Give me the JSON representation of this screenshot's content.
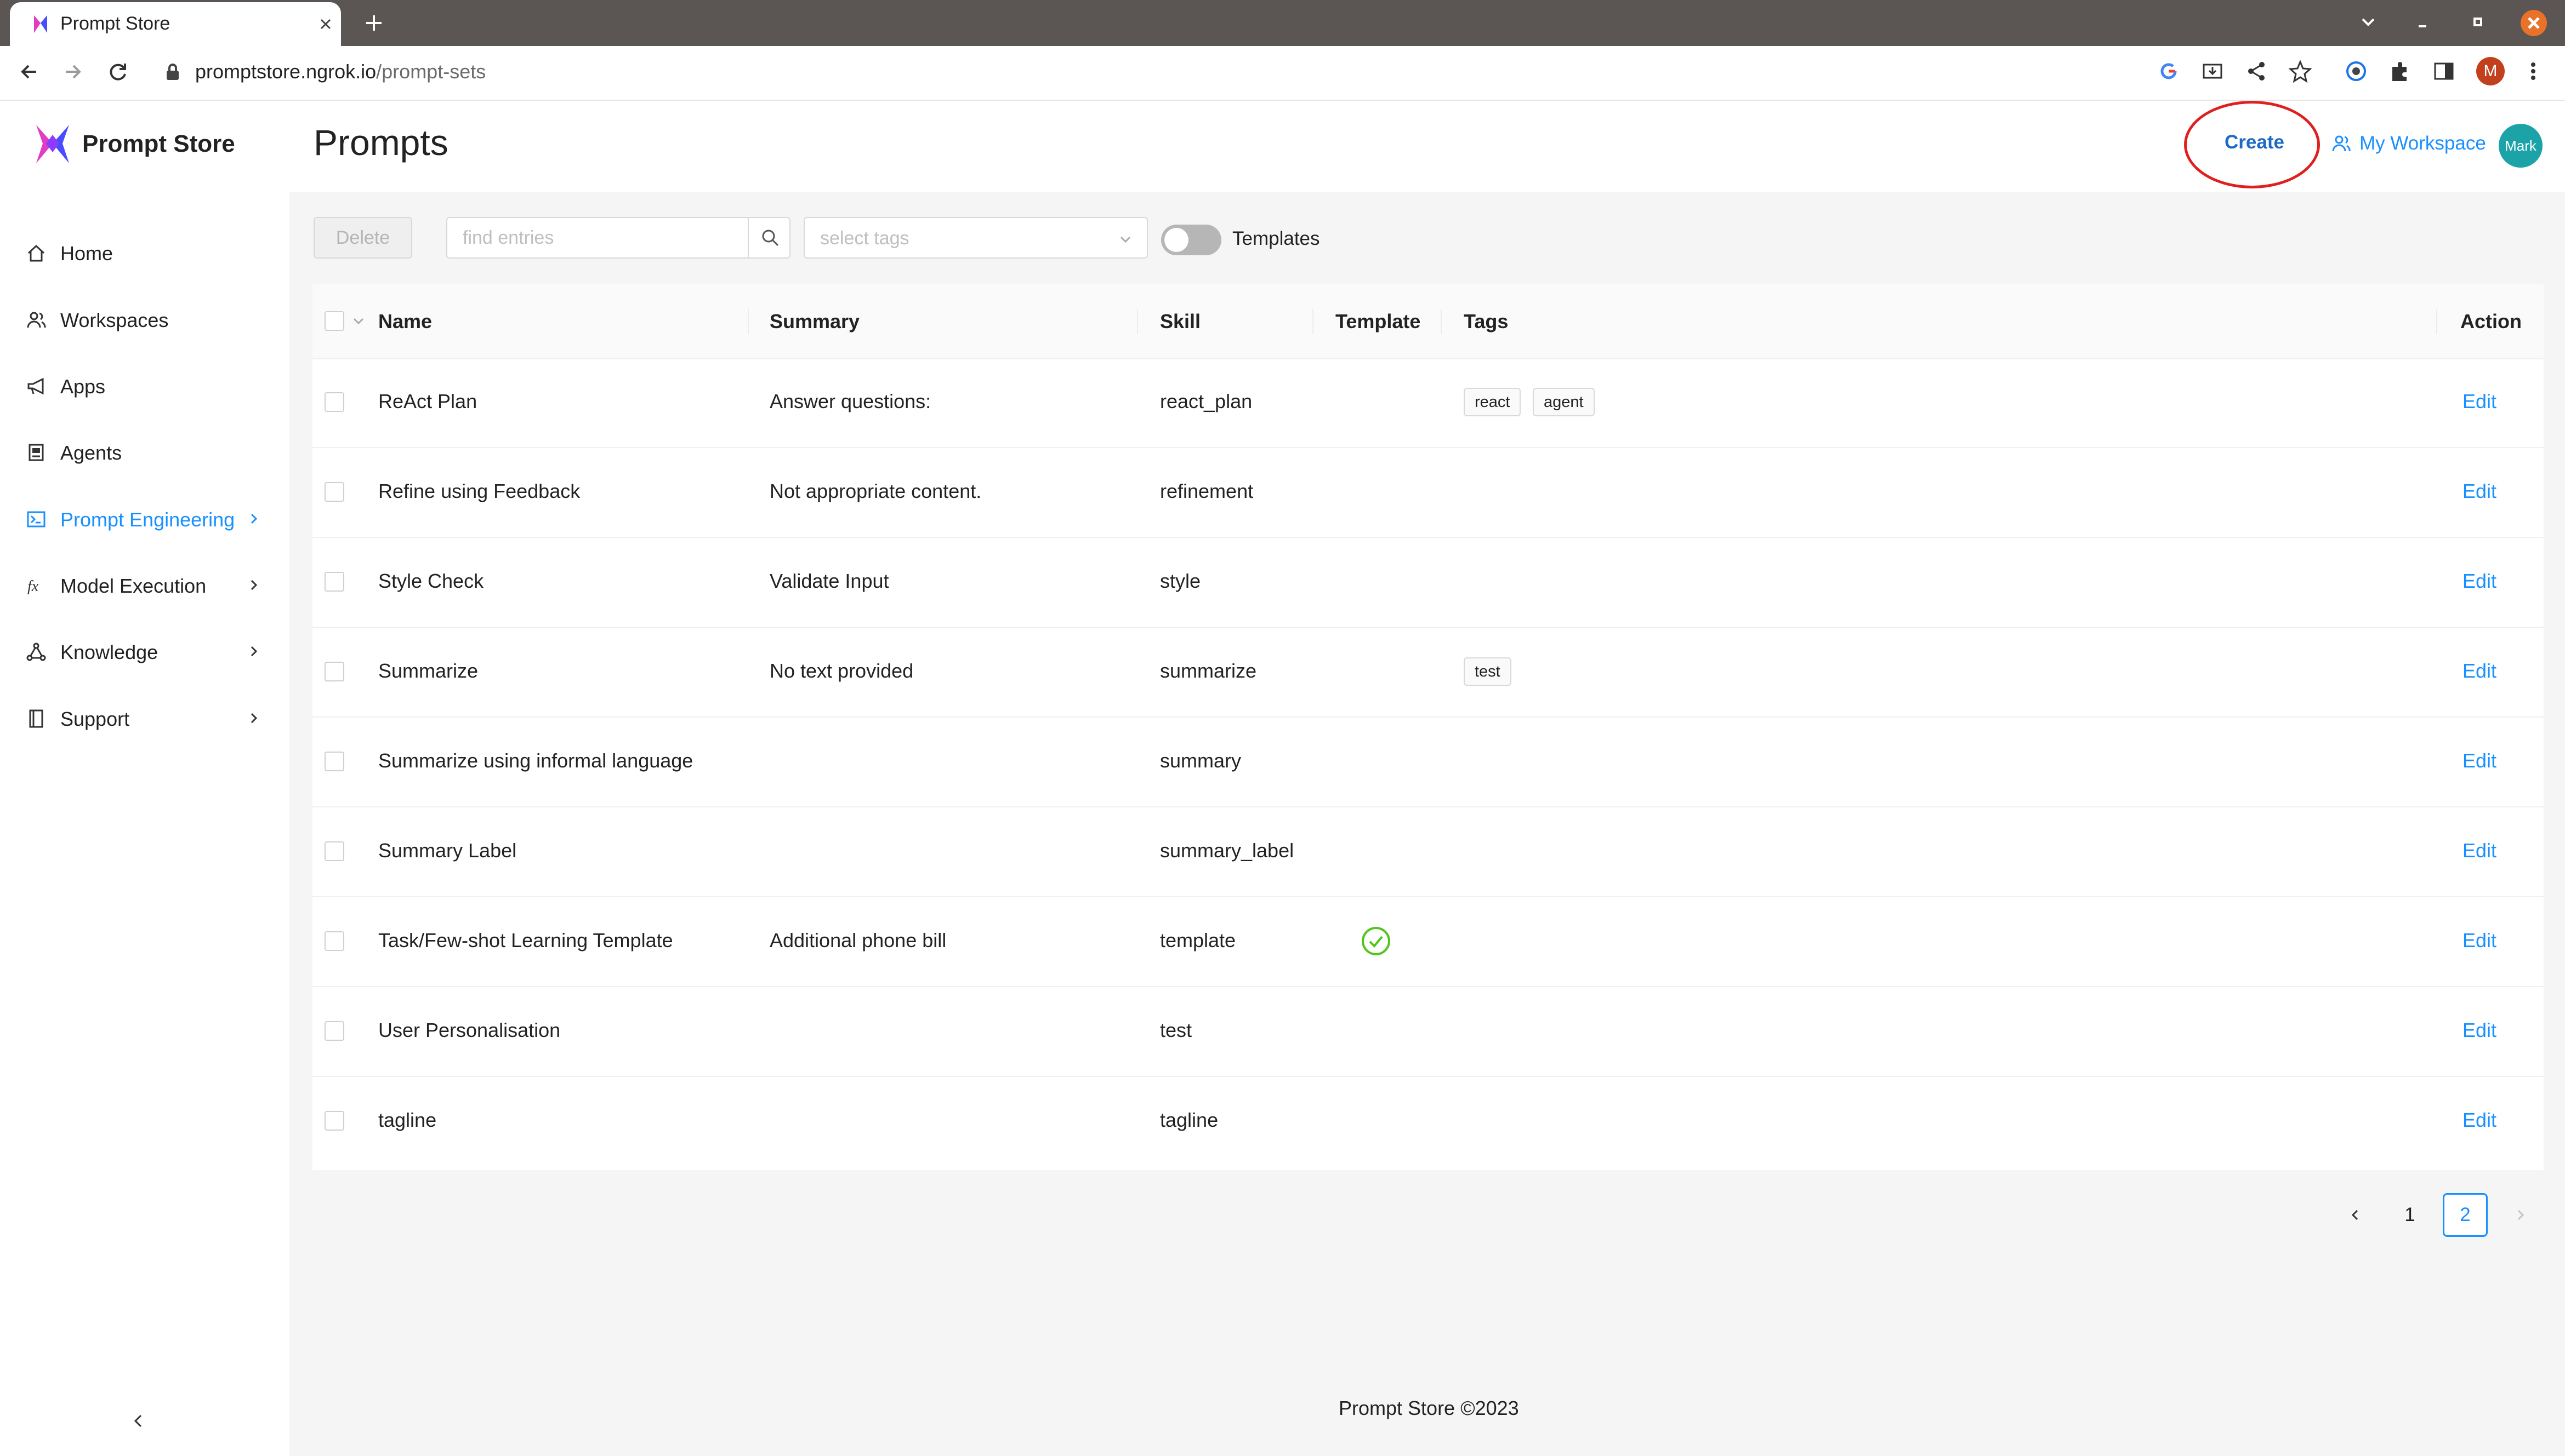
{
  "browser": {
    "tab_title": "Prompt Store",
    "url_host": "promptstore.ngrok.io",
    "url_path": "/prompt-sets",
    "profile_initial": "M"
  },
  "sidebar": {
    "brand": "Prompt Store",
    "items": [
      {
        "label": "Home",
        "icon": "home-icon"
      },
      {
        "label": "Workspaces",
        "icon": "people-icon"
      },
      {
        "label": "Apps",
        "icon": "megaphone-icon"
      },
      {
        "label": "Agents",
        "icon": "robot-icon"
      },
      {
        "label": "Prompt Engineering",
        "icon": "terminal-icon",
        "active": true
      },
      {
        "label": "Model Execution",
        "icon": "fx-icon"
      },
      {
        "label": "Knowledge",
        "icon": "network-icon"
      },
      {
        "label": "Support",
        "icon": "book-icon"
      }
    ]
  },
  "header": {
    "title": "Prompts",
    "create_label": "Create",
    "workspace_label": "My Workspace",
    "avatar_label": "Mark"
  },
  "toolbar": {
    "delete_label": "Delete",
    "search_placeholder": "find entries",
    "tags_placeholder": "select tags",
    "templates_label": "Templates"
  },
  "table": {
    "columns": [
      "Name",
      "Summary",
      "Skill",
      "Template",
      "Tags",
      "Action"
    ],
    "rows": [
      {
        "name": "ReAct Plan",
        "summary": "Answer questions:",
        "skill": "react_plan",
        "template": false,
        "tags": [
          "react",
          "agent"
        ],
        "action": "Edit"
      },
      {
        "name": "Refine using Feedback",
        "summary": "Not appropriate content.",
        "skill": "refinement",
        "template": false,
        "tags": [],
        "action": "Edit"
      },
      {
        "name": "Style Check",
        "summary": "Validate Input",
        "skill": "style",
        "template": false,
        "tags": [],
        "action": "Edit"
      },
      {
        "name": "Summarize",
        "summary": "No text provided",
        "skill": "summarize",
        "template": false,
        "tags": [
          "test"
        ],
        "action": "Edit"
      },
      {
        "name": "Summarize using informal language",
        "summary": "",
        "skill": "summary",
        "template": false,
        "tags": [],
        "action": "Edit"
      },
      {
        "name": "Summary Label",
        "summary": "",
        "skill": "summary_label",
        "template": false,
        "tags": [],
        "action": "Edit"
      },
      {
        "name": "Task/Few-shot Learning Template",
        "summary": "Additional phone bill",
        "skill": "template",
        "template": true,
        "tags": [],
        "action": "Edit"
      },
      {
        "name": "User Personalisation",
        "summary": "",
        "skill": "test",
        "template": false,
        "tags": [],
        "action": "Edit"
      },
      {
        "name": "tagline",
        "summary": "",
        "skill": "tagline",
        "template": false,
        "tags": [],
        "action": "Edit"
      }
    ]
  },
  "pagination": {
    "pages": [
      "1",
      "2"
    ],
    "current": "2"
  },
  "footer": "Prompt Store ©2023",
  "colors": {
    "accent": "#1890ff",
    "create": "#1c6ac4",
    "annotation_circle": "#e0201e",
    "avatar": "#1ba3a8",
    "success": "#52c41a"
  }
}
